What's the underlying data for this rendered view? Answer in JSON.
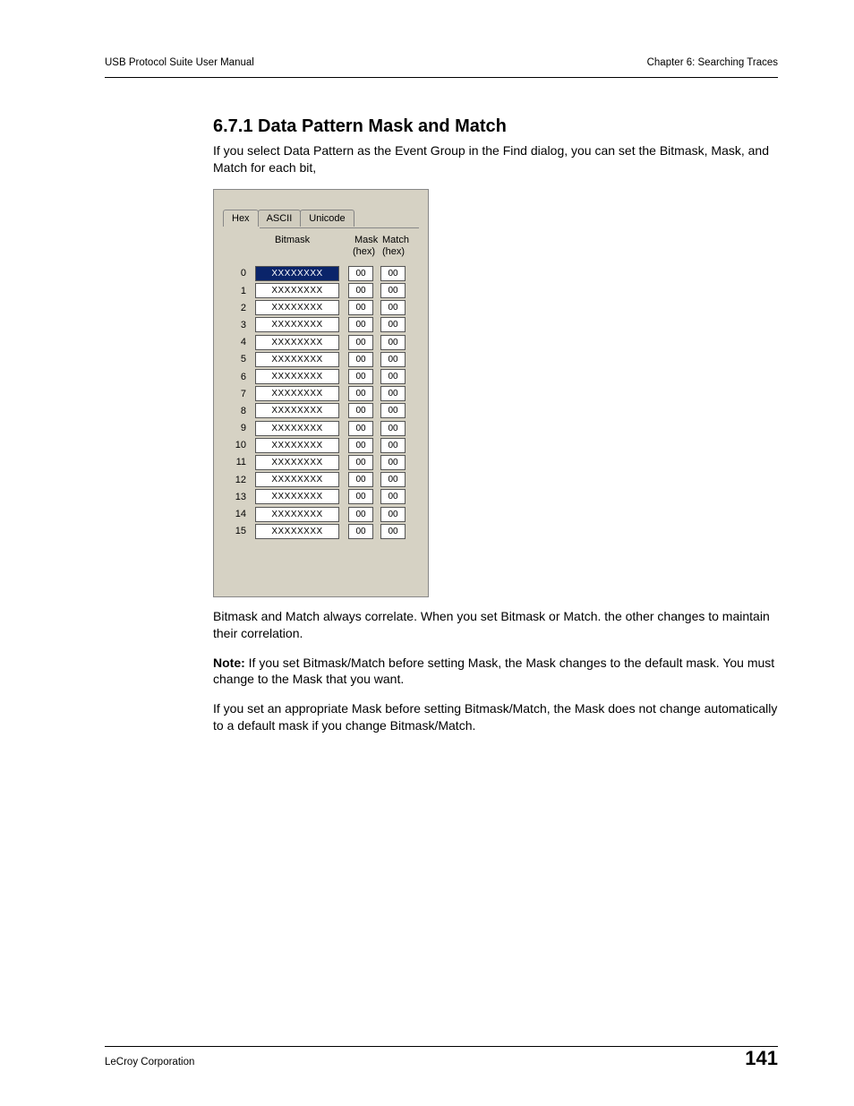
{
  "header": {
    "left": "USB Protocol Suite User Manual",
    "right": "Chapter 6: Searching Traces"
  },
  "heading": "6.7.1 Data Pattern Mask and Match",
  "p1": "If you select Data Pattern as the Event Group in the Find dialog, you can set the Bitmask, Mask, and Match for each bit,",
  "p2": "Bitmask and Match always correlate. When you set Bitmask or Match. the other changes to maintain their correlation.",
  "note_label": "Note:",
  "p3": " If you set Bitmask/Match before setting Mask, the Mask changes to the default mask. You must change to the Mask that you want.",
  "p4": "If you set an appropriate Mask before setting Bitmask/Match, the Mask does not change automatically to a default mask if you change Bitmask/Match.",
  "tabs": {
    "hex": "Hex",
    "ascii": "ASCII",
    "unicode": "Unicode"
  },
  "columns": {
    "bitmask": "Bitmask",
    "mask": "Mask",
    "match": "Match",
    "hex1": "(hex)",
    "hex2": "(hex)"
  },
  "rows": [
    {
      "i": "0",
      "b": "XXXXXXXX",
      "m": "00",
      "t": "00",
      "sel": true
    },
    {
      "i": "1",
      "b": "XXXXXXXX",
      "m": "00",
      "t": "00"
    },
    {
      "i": "2",
      "b": "XXXXXXXX",
      "m": "00",
      "t": "00"
    },
    {
      "i": "3",
      "b": "XXXXXXXX",
      "m": "00",
      "t": "00"
    },
    {
      "i": "4",
      "b": "XXXXXXXX",
      "m": "00",
      "t": "00"
    },
    {
      "i": "5",
      "b": "XXXXXXXX",
      "m": "00",
      "t": "00"
    },
    {
      "i": "6",
      "b": "XXXXXXXX",
      "m": "00",
      "t": "00"
    },
    {
      "i": "7",
      "b": "XXXXXXXX",
      "m": "00",
      "t": "00"
    },
    {
      "i": "8",
      "b": "XXXXXXXX",
      "m": "00",
      "t": "00"
    },
    {
      "i": "9",
      "b": "XXXXXXXX",
      "m": "00",
      "t": "00"
    },
    {
      "i": "10",
      "b": "XXXXXXXX",
      "m": "00",
      "t": "00"
    },
    {
      "i": "11",
      "b": "XXXXXXXX",
      "m": "00",
      "t": "00"
    },
    {
      "i": "12",
      "b": "XXXXXXXX",
      "m": "00",
      "t": "00"
    },
    {
      "i": "13",
      "b": "XXXXXXXX",
      "m": "00",
      "t": "00"
    },
    {
      "i": "14",
      "b": "XXXXXXXX",
      "m": "00",
      "t": "00"
    },
    {
      "i": "15",
      "b": "XXXXXXXX",
      "m": "00",
      "t": "00"
    }
  ],
  "footer": {
    "corp": "LeCroy Corporation",
    "page": "141"
  }
}
